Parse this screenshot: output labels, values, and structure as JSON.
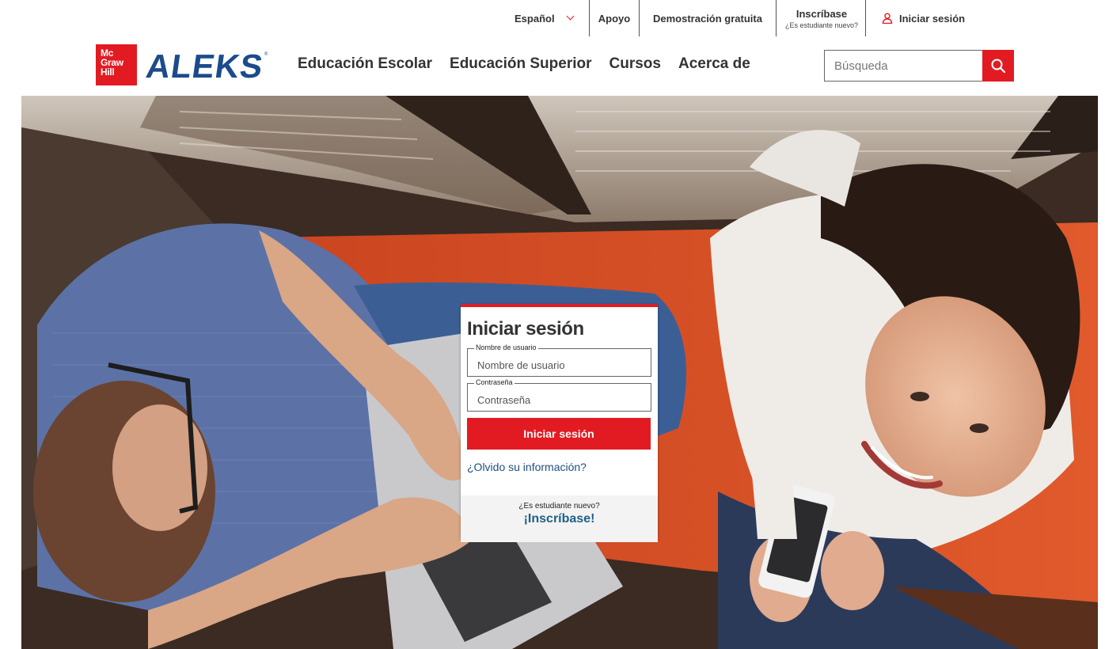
{
  "utility": {
    "language": "Español",
    "support": "Apoyo",
    "demo": "Demostración gratuita",
    "register": "Inscríbase",
    "register_sub": "¿Es estudiante nuevo?",
    "login": "Iniciar sesión"
  },
  "brand": {
    "mh_logo_lines": [
      "Mc",
      "Graw",
      "Hill"
    ],
    "product": "ALEKS",
    "registered": "®"
  },
  "nav": {
    "items": [
      "Educación Escolar",
      "Educación Superior",
      "Cursos",
      "Acerca de"
    ]
  },
  "search": {
    "placeholder": "Búsqueda",
    "icon": "search-icon"
  },
  "login_card": {
    "title": "Iniciar sesión",
    "username_label": "Nombre de usuario",
    "username_placeholder": "Nombre de usuario",
    "password_label": "Contraseña",
    "password_placeholder": "Contraseña",
    "submit": "Iniciar sesión",
    "forgot": "¿Olvido su información?",
    "new_student": "¿Es estudiante nuevo?",
    "signup": "¡Inscríbase!"
  },
  "colors": {
    "brand_red": "#e21b23",
    "aleks_blue": "#1c4b8c",
    "link_blue": "#1f4f7f"
  }
}
